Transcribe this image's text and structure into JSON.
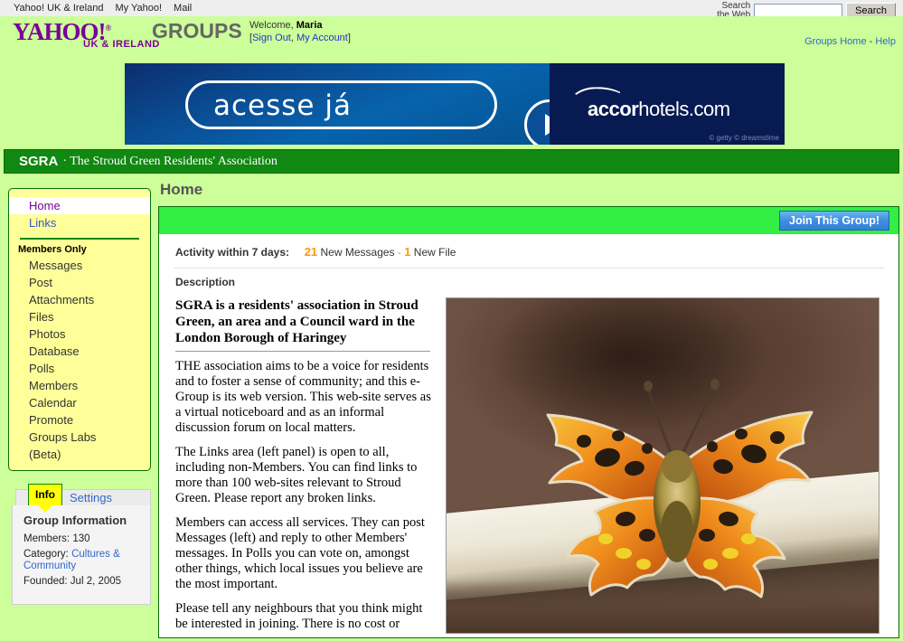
{
  "topbar": {
    "links": [
      "Yahoo! UK & Ireland",
      "My Yahoo!",
      "Mail"
    ],
    "search_label_line1": "Search",
    "search_label_line2": "the Web",
    "search_value": "",
    "search_placeholder": "",
    "search_button": "Search"
  },
  "brand": {
    "logo_text": "YAHOO!",
    "logo_reg": "®",
    "logo_sub": "UK & IRELAND",
    "product": "GROUPS",
    "welcome_prefix": "Welcome, ",
    "welcome_user": "Maria",
    "sign_out": "Sign Out",
    "my_account": "My Account",
    "groups_home": "Groups Home",
    "help": "Help",
    "separator": " - "
  },
  "ad": {
    "left_text": "acesse já",
    "right_brand_bold": "accor",
    "right_brand_rest": "hotels.com",
    "credit": "© getty © dreamstime"
  },
  "group_header": {
    "abbr": "SGRA",
    "full": "· The Stroud Green Residents' Association"
  },
  "sidebar": {
    "public_items": [
      {
        "label": "Home",
        "current": true
      },
      {
        "label": "Links",
        "current": false
      }
    ],
    "section_title": "Members Only",
    "member_items": [
      "Messages",
      "Post",
      "Attachments",
      "Files",
      "Photos",
      "Database",
      "Polls",
      "Members",
      "Calendar",
      "Promote",
      "Groups Labs",
      "(Beta)"
    ],
    "tabs": [
      {
        "label": "Info",
        "active": true
      },
      {
        "label": "Settings",
        "active": false
      }
    ],
    "info": {
      "heading": "Group Information",
      "members_label": "Members: ",
      "members_value": "130",
      "category_label": "Category: ",
      "category_value": "Cultures & Community",
      "founded_label": "Founded: ",
      "founded_value": "Jul 2, 2005"
    }
  },
  "main": {
    "page_title": "Home",
    "join_button": "Join This Group!",
    "activity_label": "Activity within 7 days:",
    "activity_messages_count": "21",
    "activity_messages_text": " New Messages ",
    "activity_separator": "- ",
    "activity_files_count": "1",
    "activity_files_text": " New File",
    "description_heading": "Description",
    "description_title": "SGRA is a residents' association in Stroud Green, an area and a Council ward in the London Borough of Haringey",
    "paragraphs": [
      "THE association aims to be a voice for residents and to foster a sense of community; and this e-Group is its web version. This web-site serves as a virtual noticeboard and as an informal discussion forum on local matters.",
      "The Links area (left panel) is open to all, including non-Members. You can find links to more than 100 web-sites relevant to Stroud Green. Please report any broken links.",
      "Members can access all services. They can post Messages (left) and reply to other Members' messages. In Polls you can vote on, amongst other things, which local issues you believe are the most important.",
      "Please tell any neighbours that you think might be interested in joining. There is no cost or"
    ],
    "photo_alt": "Comma butterfly resting on a pale metal rail"
  },
  "colors": {
    "page_bg": "#ccff99",
    "group_header_green": "#118811",
    "sidebar_yellow": "#ffff99",
    "accent_orange": "#ff9900",
    "link_blue": "#3366cc",
    "yahoo_purple": "#7b0099",
    "join_bar_green": "#33ee44",
    "tab_active_yellow": "#ffff00"
  }
}
